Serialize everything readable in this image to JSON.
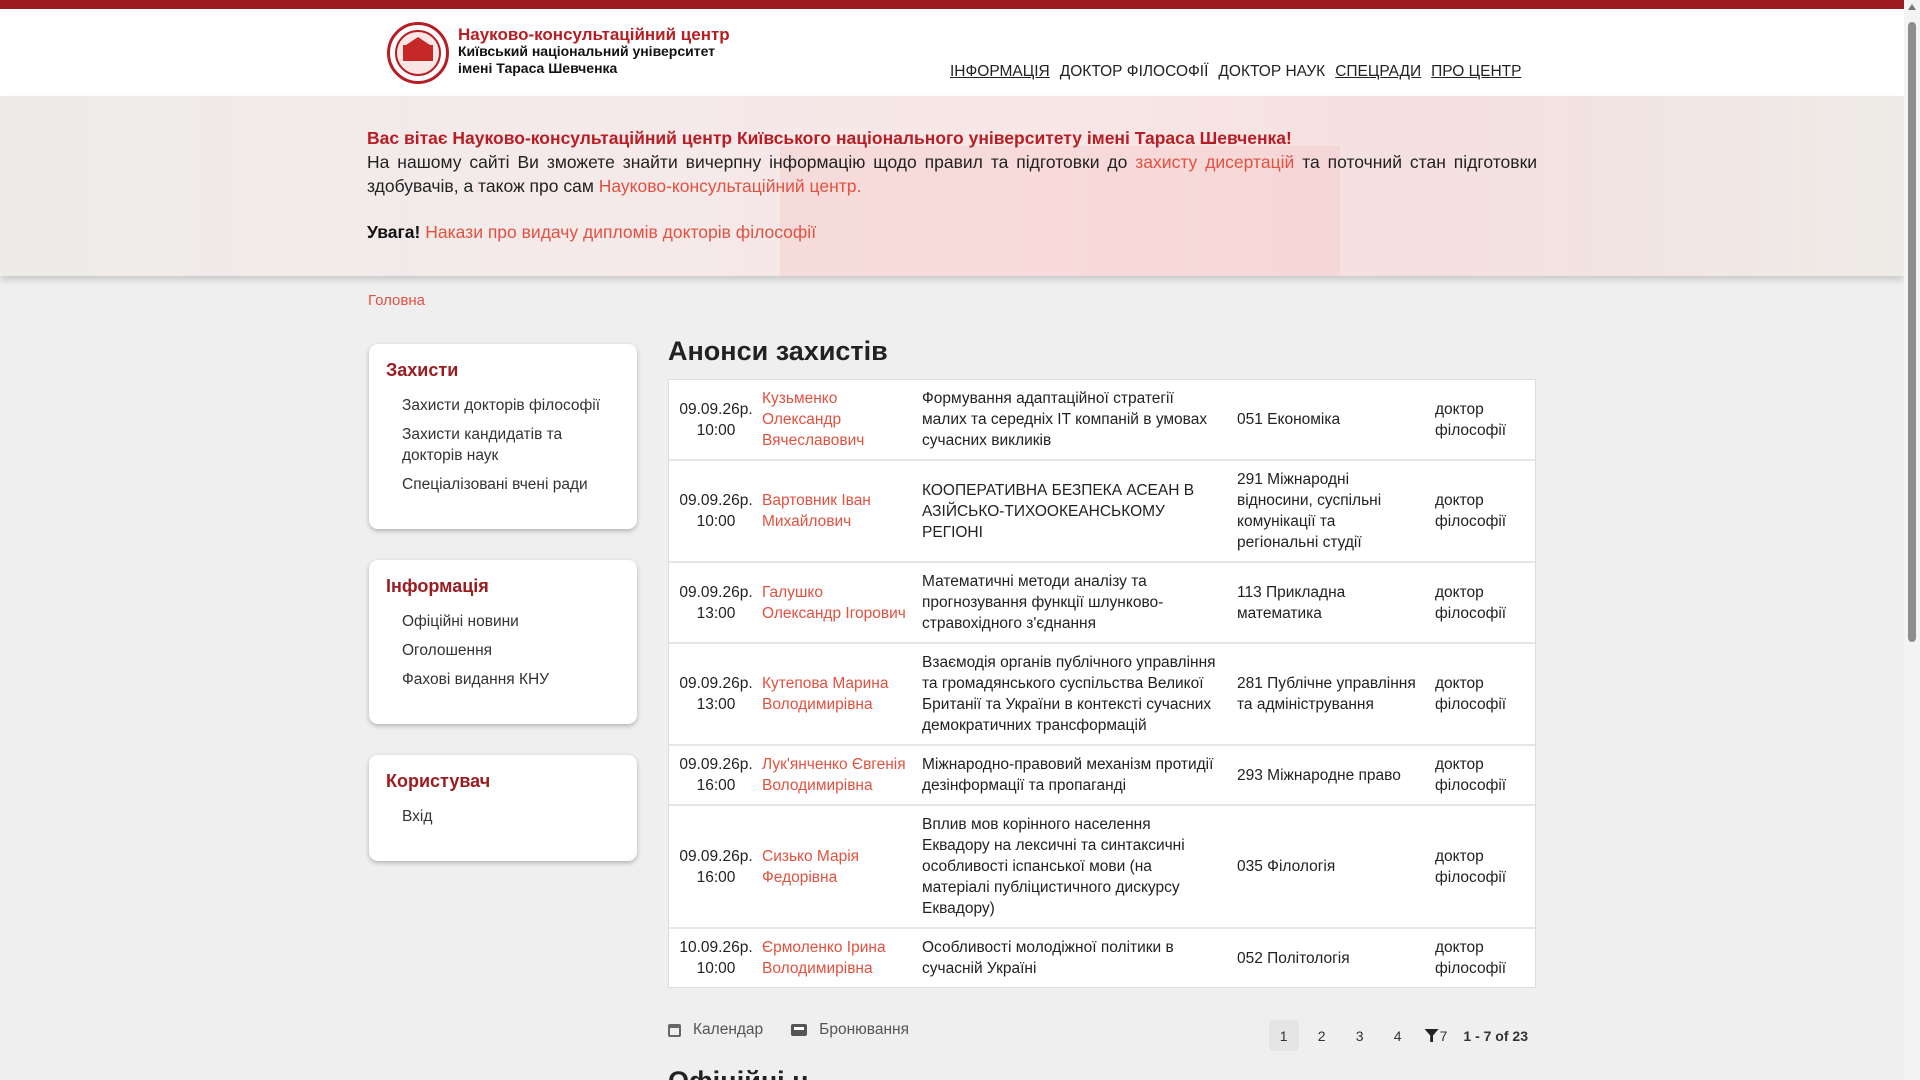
{
  "brand": {
    "line1": "Науково-консультаційний центр",
    "line2": "Київський національний університет",
    "line3": "імені Тараса Шевченка"
  },
  "nav": {
    "items": [
      "ІНФОРМАЦІЯ",
      "ДОКТОР ФІЛОСОФІЇ",
      "ДОКТОР НАУК",
      "СПЕЦРАДИ",
      "ПРО ЦЕНТР"
    ]
  },
  "hero": {
    "welcome": "Вас вітає Науково-консультаційний центр Київського національного університету імені Тараса Шевченка!",
    "text_before": "На нашому сайті Ви зможете знайти вичерпну інформацію щодо правил та підготовки до ",
    "link1": "захисту дисертацій",
    "text_middle": " та поточний стан підготовки здобувачів, а також про сам ",
    "link2": "Науково-консультаційний центр.",
    "warn_label": "Увага!",
    "warn_link": "Накази про видачу дипломів докторів філософії"
  },
  "breadcrumb": "Головна",
  "sidebar": {
    "boxes": [
      {
        "title": "Захисти",
        "items": [
          "Захисти докторів філософії",
          "Захисти кандидатів та докторів наук",
          "Спеціалізовані вчені ради"
        ]
      },
      {
        "title": "Інформація",
        "items": [
          "Офіційні новини",
          "Оголошення",
          "Фахові видання КНУ"
        ]
      },
      {
        "title": "Користувач",
        "items": [
          "Вхід"
        ]
      }
    ]
  },
  "main": {
    "title": "Анонси захистів",
    "rows": [
      {
        "date": "09.09.26р. 10:00",
        "name": "Кузьменко Олександр Вячеславович",
        "title": "Формування адаптаційної стратегії малих та середніх IT компаній в умовах сучасних викликів",
        "spec": "051 Економіка",
        "degree": "доктор філософії"
      },
      {
        "date": "09.09.26р. 10:00",
        "name": "Вартовник Іван Михайлович",
        "title": "КООПЕРАТИВНА БЕЗПЕКА АСЕАН В АЗІЙСЬКО-ТИХООКЕАНСЬКОМУ РЕГІОНІ",
        "spec": "291 Міжнародні відносини, суспільні комунікації та регіональні студії",
        "degree": "доктор філософії"
      },
      {
        "date": "09.09.26р. 13:00",
        "name": "Галушко Олександр Ігорович",
        "title": "Математичні методи аналізу та прогнозування функції шлунково-стравохідного з'єднання",
        "spec": "113 Прикладна математика",
        "degree": "доктор філософії"
      },
      {
        "date": "09.09.26р. 13:00",
        "name": "Кутепова Марина Володимирівна",
        "title": "Взаємодія органів публічного управління та громадянського суспільства Великої Британії та України в контексті сучасних демократичних трансформацій",
        "spec": "281 Публічне управління та адміністрування",
        "degree": "доктор філософії"
      },
      {
        "date": "09.09.26р. 16:00",
        "name": "Лук'янченко Євгенія Володимирівна",
        "title": "Міжнародно-правовий механізм протидії дезінформації та пропаганді",
        "spec": "293 Міжнародне право",
        "degree": "доктор філософії"
      },
      {
        "date": "09.09.26р. 16:00",
        "name": "Сизько Марія Федорівна",
        "title": "Вплив мов корінного населення Еквадору на лексичні та синтаксичні особливості іспанської мови (на матеріалі публіцистичного дискурсу Еквадору)",
        "spec": "035 Філологія",
        "degree": "доктор філософії"
      },
      {
        "date": "10.09.26р. 10:00",
        "name": "Єрмоленко Ірина Володимирівна",
        "title": "Особливості молодіжної політики в сучасній Україні",
        "spec": "052 Політологія",
        "degree": "доктор філософії"
      }
    ]
  },
  "bottom": {
    "calendar": "Календар",
    "booking": "Бронювання",
    "pages": [
      "1",
      "2",
      "3",
      "4"
    ],
    "filter_count": "7",
    "range": "1 - 7 of 23"
  },
  "next_heading": "Офіційні н"
}
